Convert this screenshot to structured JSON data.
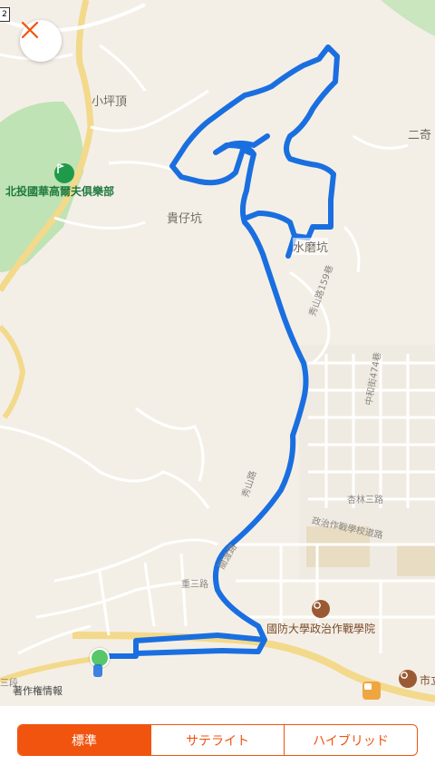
{
  "map": {
    "labels": {
      "xiaopingding": "小坪頂",
      "golf_club": "北投國華高爾夫俱樂部",
      "guizaikeng": "貴仔坑",
      "shuimokeng": "水磨坑",
      "erqi": "二奇",
      "xiushan_lane": "秀山路159巷",
      "zhonghe_street": "中和街474巷",
      "xiushan_road": "秀山路",
      "xinglin_road": "杏林三路",
      "zhengzhi_road": "政治作戰學校道路",
      "zhongsan": "重三路",
      "gaosu_road": "關渡路",
      "national_univ": "國防大學政治作戰學院",
      "sanduan": "三段",
      "copyright": "著作権情報",
      "city_label": "市立",
      "corner_badge": "2"
    },
    "route_color": "#1a6fe0",
    "start_marker_color": "#58c76a"
  },
  "modes": {
    "standard": "標準",
    "satellite": "サテライト",
    "hybrid": "ハイブリッド",
    "selected": "standard"
  },
  "accent_color": "#f0540f"
}
